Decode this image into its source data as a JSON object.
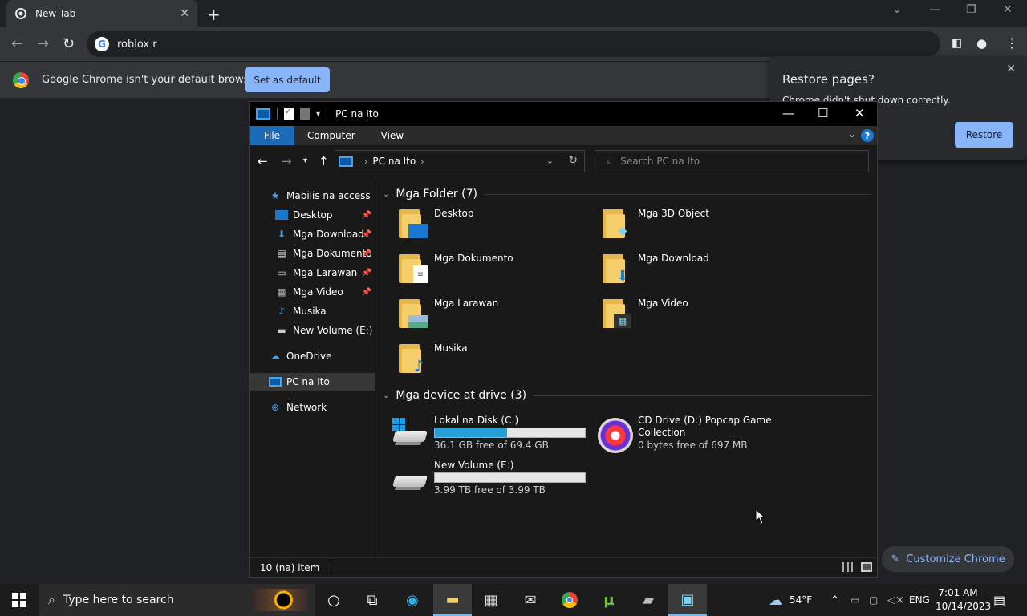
{
  "chrome": {
    "tab_title": "New Tab",
    "omnibox_text": "roblox r",
    "infobar_message": "Google Chrome isn't your default browser",
    "set_default_label": "Set as default",
    "restore_title": "Restore pages?",
    "restore_subtitle": "Chrome didn't shut down correctly.",
    "restore_button": "Restore",
    "customize_label": "Customize Chrome"
  },
  "explorer": {
    "title": "PC na Ito",
    "ribbon_tabs": [
      "File",
      "Computer",
      "View"
    ],
    "address": "PC na Ito",
    "search_placeholder": "Search PC na Ito",
    "nav": {
      "quick_access": "Mabilis na access",
      "desktop": "Desktop",
      "downloads": "Mga Download",
      "documents": "Mga Dokumento",
      "pictures": "Mga Larawan",
      "videos": "Mga Video",
      "music": "Musika",
      "new_volume": "New Volume (E:)",
      "onedrive": "OneDrive",
      "this_pc": "PC na Ito",
      "network": "Network"
    },
    "folders_header": "Mga Folder (7)",
    "folders": {
      "desktop": "Desktop",
      "objects3d": "Mga 3D Object",
      "documents": "Mga Dokumento",
      "downloads": "Mga Download",
      "pictures": "Mga Larawan",
      "videos": "Mga Video",
      "music": "Musika"
    },
    "drives_header": "Mga device at drive (3)",
    "drives": {
      "c_name": "Lokal na Disk (C:)",
      "c_free": "36.1 GB free of 69.4 GB",
      "c_used_fraction": 0.48,
      "d_name_1": "CD Drive (D:) Popcap Game",
      "d_name_2": "Collection",
      "d_free": "0 bytes free of 697 MB",
      "e_name": "New Volume (E:)",
      "e_free": "3.99 TB free of 3.99 TB",
      "e_used_fraction": 0.0
    },
    "status_text": "10 (na) item"
  },
  "taskbar": {
    "search_placeholder": "Type here to search",
    "weather_temp": "54°F",
    "language": "ENG",
    "time": "7:01 AM",
    "date": "10/14/2023"
  }
}
